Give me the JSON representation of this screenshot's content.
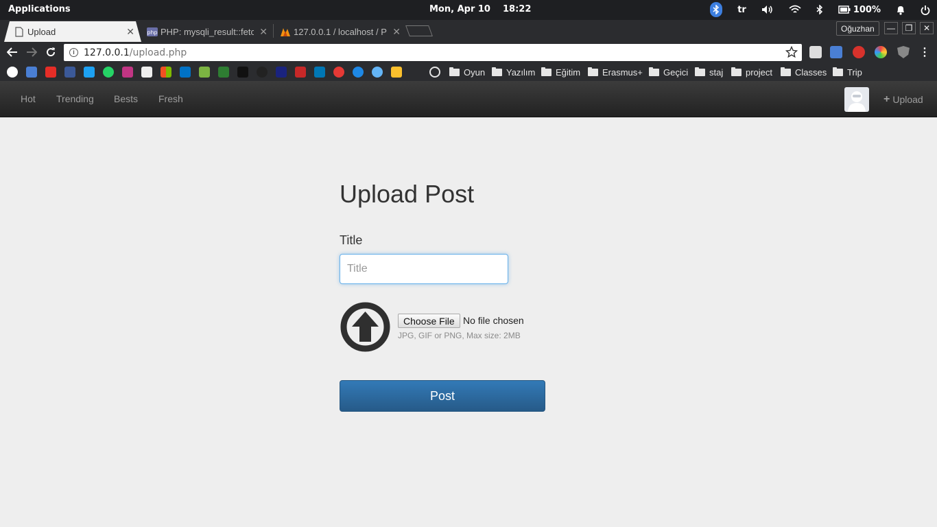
{
  "system": {
    "apps_label": "Applications",
    "date": "Mon, Apr 10",
    "time": "18:22",
    "keyboard_layout": "tr",
    "battery": "100%"
  },
  "browser": {
    "tabs": [
      {
        "title": "Upload",
        "active": true
      },
      {
        "title": "PHP: mysqli_result::fetc",
        "active": false
      },
      {
        "title": "127.0.0.1 / localhost / P",
        "active": false
      }
    ],
    "user": "Oğuzhan",
    "url_host": "127.0.0.1",
    "url_path": "/upload.php",
    "bookmark_folders": [
      "Oyun",
      "Yazılım",
      "Eğitim",
      "Erasmus+",
      "Geçici",
      "staj",
      "project",
      "Classes",
      "Trip"
    ]
  },
  "site": {
    "nav": [
      "Hot",
      "Trending",
      "Bests",
      "Fresh"
    ],
    "upload_label": "Upload"
  },
  "form": {
    "heading": "Upload Post",
    "title_label": "Title",
    "title_placeholder": "Title",
    "title_value": "",
    "choose_file_label": "Choose File",
    "file_status": "No file chosen",
    "file_help": "JPG, GIF or PNG, Max size: 2MB",
    "submit_label": "Post"
  },
  "colors": {
    "primary_button": "#337ab7",
    "navbar": "#222222",
    "page_background": "#eeeeee",
    "input_focus": "#66afe9"
  }
}
